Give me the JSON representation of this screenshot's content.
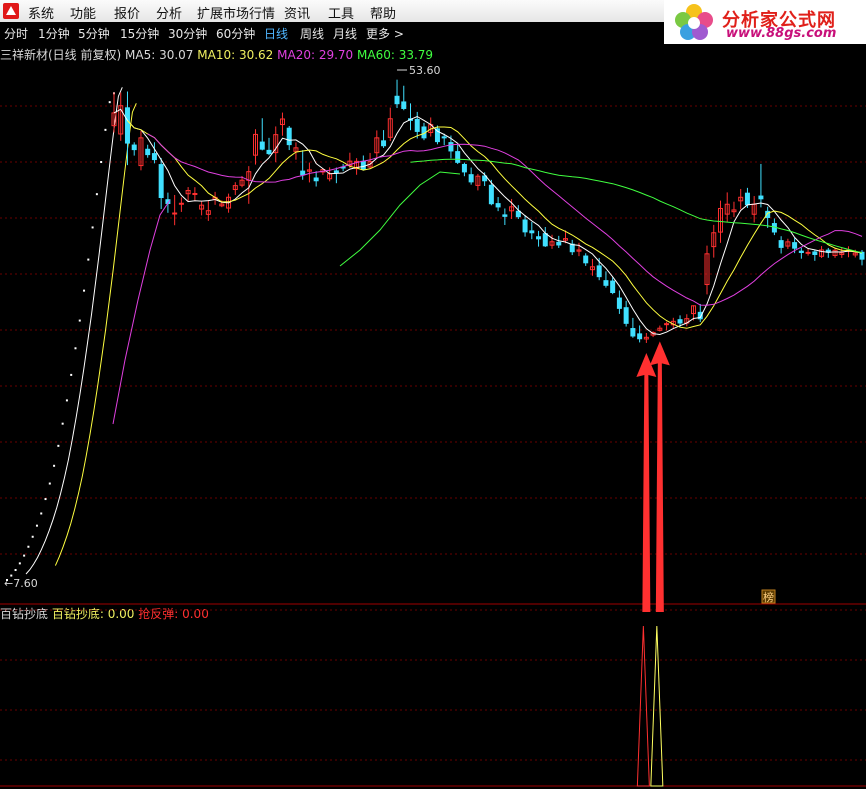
{
  "menu": {
    "items": [
      "系统",
      "功能",
      "报价",
      "分析",
      "扩展市场行情",
      "资讯",
      "工具",
      "帮助"
    ]
  },
  "logo": {
    "text_cn": "分析家公式网",
    "url": "www.88gs.com"
  },
  "periods": {
    "items": [
      "分时",
      "1分钟",
      "5分钟",
      "15分钟",
      "30分钟",
      "60分钟",
      "日线",
      "周线",
      "月线",
      "更多 >"
    ],
    "active": "日线"
  },
  "stock": {
    "title": "三祥新材(日线 前复权)",
    "ma5_label": "MA5: 30.07",
    "ma10_label": "MA10: 30.62",
    "ma20_label": "MA20: 29.70",
    "ma60_label": "MA60: 33.79",
    "high_label": "53.60",
    "low_label": "7.60",
    "badge": "榜"
  },
  "indicator": {
    "name": "百钻抄底",
    "line1_label": "百钻抄底: 0.00",
    "line2_label": "抢反弹: 0.00"
  },
  "colors": {
    "up": "#ff3030",
    "down": "#40e0ff",
    "ma5": "#ffffff",
    "ma10": "#ffff40",
    "ma20": "#e040e0",
    "ma60": "#40ff40",
    "arrow": "#ff3030",
    "grid": "#6a0000"
  },
  "chart_data": {
    "type": "candlestick",
    "price_range": [
      7.6,
      53.6
    ],
    "candles": [
      [
        48.58,
        51.57,
        47.95,
        49.73
      ],
      [
        47.83,
        51.57,
        47.21,
        50.38
      ],
      [
        50.19,
        51.66,
        45.02,
        47.01
      ],
      [
        46.83,
        47.08,
        45.88,
        46.42
      ],
      [
        44.98,
        48.11,
        44.55,
        47.48
      ],
      [
        46.45,
        46.86,
        45.69,
        45.97
      ],
      [
        46.06,
        47.08,
        45.18,
        45.52
      ],
      [
        45.07,
        45.66,
        41.06,
        42.1
      ],
      [
        41.9,
        42.54,
        40.72,
        41.56
      ],
      [
        40.63,
        42.33,
        39.6,
        40.7
      ],
      [
        41.51,
        42.11,
        40.8,
        41.58
      ],
      [
        42.44,
        43.04,
        41.74,
        42.73
      ],
      [
        42.44,
        43.03,
        41.81,
        42.46
      ],
      [
        41.06,
        41.73,
        40.49,
        41.41
      ],
      [
        40.58,
        41.84,
        39.99,
        40.91
      ],
      [
        41.94,
        42.61,
        41.44,
        42.11
      ],
      [
        41.35,
        41.84,
        41.23,
        41.51
      ],
      [
        41.15,
        42.45,
        40.73,
        42.12
      ],
      [
        42.82,
        43.48,
        42.33,
        43.17
      ],
      [
        43.21,
        44.04,
        43.02,
        43.66
      ],
      [
        43.65,
        44.93,
        41.53,
        44.43
      ],
      [
        45.92,
        48.26,
        45.07,
        47.79
      ],
      [
        47.1,
        49.25,
        46.35,
        46.46
      ],
      [
        46.35,
        47.48,
        45.92,
        46.06
      ],
      [
        46.15,
        48.51,
        45.29,
        47.77
      ],
      [
        48.68,
        49.76,
        47.67,
        49.18
      ],
      [
        48.35,
        48.55,
        46.38,
        46.87
      ],
      [
        46.26,
        47.07,
        45.51,
        46.58
      ],
      [
        44.48,
        46.37,
        43.7,
        44.15
      ],
      [
        44.47,
        45.25,
        43.46,
        44.59
      ],
      [
        43.86,
        44.47,
        43.09,
        43.61
      ],
      [
        44.4,
        44.71,
        44.14,
        44.62
      ],
      [
        43.79,
        44.82,
        43.56,
        44.24
      ],
      [
        44.5,
        44.8,
        43.39,
        44.31
      ],
      [
        44.85,
        45.13,
        44.47,
        44.76
      ],
      [
        44.98,
        46.14,
        44.77,
        45.38
      ],
      [
        44.71,
        45.65,
        44.15,
        45.36
      ],
      [
        45.36,
        45.89,
        44.52,
        44.66
      ],
      [
        44.85,
        46.12,
        44.7,
        45.34
      ],
      [
        46.14,
        48.15,
        45.68,
        47.48
      ],
      [
        47.21,
        48.18,
        46.57,
        46.77
      ],
      [
        47.53,
        50.21,
        47.19,
        49.2
      ],
      [
        51.23,
        52.73,
        50.17,
        50.56
      ],
      [
        50.72,
        52.18,
        49.97,
        50.13
      ],
      [
        49.2,
        50.59,
        48.17,
        49.06
      ],
      [
        49.14,
        49.82,
        47.42,
        48.06
      ],
      [
        48.46,
        48.84,
        47.27,
        47.48
      ],
      [
        47.96,
        49.32,
        47.6,
        48.67
      ],
      [
        48.29,
        48.59,
        46.9,
        47.14
      ],
      [
        47.57,
        47.85,
        46.82,
        47.55
      ],
      [
        47.05,
        47.69,
        45.63,
        46.3
      ],
      [
        46.24,
        46.85,
        45.12,
        45.27
      ],
      [
        45.08,
        45.25,
        44.02,
        44.41
      ],
      [
        44.16,
        44.8,
        43.26,
        43.51
      ],
      [
        43.19,
        44.23,
        42.74,
        44.02
      ],
      [
        44.04,
        44.37,
        43.14,
        43.61
      ],
      [
        43.2,
        43.69,
        41.4,
        41.54
      ],
      [
        41.55,
        42.14,
        40.87,
        41.25
      ],
      [
        40.53,
        41.11,
        39.62,
        40.4
      ],
      [
        40.9,
        41.97,
        40.16,
        41.26
      ],
      [
        40.86,
        41.41,
        40.16,
        40.37
      ],
      [
        40.07,
        40.5,
        38.57,
        39.0
      ],
      [
        39.09,
        39.9,
        38.34,
        38.92
      ],
      [
        38.56,
        39.09,
        37.67,
        38.37
      ],
      [
        38.84,
        39.44,
        37.64,
        37.74
      ],
      [
        37.8,
        38.74,
        37.47,
        38.11
      ],
      [
        38.06,
        38.64,
        37.55,
        37.82
      ],
      [
        38.25,
        39.13,
        37.98,
        38.39
      ],
      [
        37.89,
        38.28,
        36.91,
        37.21
      ],
      [
        37.26,
        38.02,
        36.81,
        37.37
      ],
      [
        36.82,
        37.07,
        35.93,
        36.21
      ],
      [
        35.59,
        36.56,
        35.04,
        35.85
      ],
      [
        35.93,
        36.65,
        34.64,
        34.96
      ],
      [
        34.6,
        35.44,
        33.97,
        34.18
      ],
      [
        34.56,
        34.9,
        33.38,
        33.53
      ],
      [
        33.03,
        33.71,
        31.6,
        32.1
      ],
      [
        32.16,
        32.78,
        30.46,
        30.75
      ],
      [
        30.28,
        31.24,
        29.45,
        29.61
      ],
      [
        29.8,
        30.56,
        29.03,
        29.36
      ],
      [
        29.34,
        29.88,
        28.98,
        29.49
      ],
      [
        29.69,
        30.03,
        29.51,
        29.93
      ],
      [
        30.12,
        30.55,
        30.02,
        30.31
      ],
      [
        30.66,
        30.9,
        30.11,
        30.72
      ],
      [
        30.62,
        31.25,
        30.29,
        30.93
      ],
      [
        31.08,
        31.47,
        30.43,
        30.78
      ],
      [
        30.78,
        31.57,
        30.48,
        31.17
      ],
      [
        31.63,
        32.38,
        31.01,
        32.33
      ],
      [
        31.74,
        32.5,
        30.87,
        31.16
      ],
      [
        34.25,
        37.76,
        33.36,
        37.02
      ],
      [
        37.67,
        39.63,
        36.68,
        38.92
      ],
      [
        38.98,
        41.82,
        38.01,
        41.11
      ],
      [
        40.6,
        42.56,
        39.88,
        41.49
      ],
      [
        40.82,
        41.72,
        40.33,
        40.98
      ],
      [
        41.8,
        42.87,
        41.04,
        42.12
      ],
      [
        42.49,
        42.97,
        41.16,
        41.46
      ],
      [
        40.59,
        42.23,
        39.85,
        41.49
      ],
      [
        42.23,
        45.13,
        41.21,
        41.98
      ],
      [
        40.85,
        41.27,
        39.36,
        40.3
      ],
      [
        39.75,
        40.21,
        38.71,
        38.99
      ],
      [
        38.21,
        38.61,
        37.05,
        37.6
      ],
      [
        37.72,
        38.38,
        37.46,
        38.1
      ],
      [
        38.03,
        38.44,
        37.08,
        37.53
      ],
      [
        37.26,
        37.56,
        36.58,
        37.14
      ],
      [
        37.13,
        37.51,
        36.86,
        37.15
      ],
      [
        37.19,
        37.36,
        36.39,
        36.96
      ],
      [
        36.8,
        37.72,
        36.64,
        37.37
      ],
      [
        37.35,
        37.55,
        36.66,
        37.16
      ],
      [
        36.87,
        37.56,
        36.66,
        37.34
      ],
      [
        36.96,
        37.57,
        36.65,
        37.11
      ],
      [
        37.27,
        37.7,
        36.71,
        37.35
      ],
      [
        36.92,
        37.39,
        36.69,
        37.09
      ],
      [
        37.16,
        37.37,
        35.98,
        36.54
      ]
    ],
    "ipo_series": [
      7.6,
      8.0,
      8.5,
      9.1,
      9.8,
      10.6,
      11.5,
      12.5,
      13.6,
      14.9,
      16.3,
      17.9,
      19.7,
      21.7,
      23.8,
      26.1,
      28.5,
      31.0,
      33.7,
      36.5,
      39.4,
      42.4,
      45.3,
      48.2,
      50.7,
      51.5
    ],
    "ma_offsets": {
      "ma10_start": 9,
      "ma20_start": 19,
      "ma60_start": 59
    },
    "arrows": [
      {
        "index": 79,
        "label": ""
      },
      {
        "index": 81,
        "label": ""
      }
    ],
    "indicator_signals": [
      {
        "index": 79,
        "series": "red",
        "value": 1.0
      },
      {
        "index": 81,
        "series": "yellow",
        "value": 1.0
      }
    ]
  }
}
